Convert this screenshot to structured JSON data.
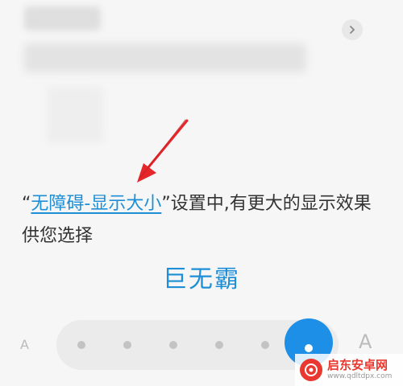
{
  "description": {
    "quote_open": "“",
    "link_text": "无障碍-显示大小",
    "quote_close": "”",
    "rest": "设置中,有更大的显示效果供您选择"
  },
  "preview_text": "巨无霸",
  "slider": {
    "min_label": "A",
    "max_label": "A",
    "positions": 6,
    "selected_index": 5
  },
  "icons": {
    "chevron": "chevron-right-icon",
    "annotation": "red-arrow-icon",
    "watermark_logo": "qdltd-logo"
  },
  "watermark": {
    "name": "启东安卓网",
    "url": "www.qdltdpx.com"
  },
  "colors": {
    "accent": "#1e8fd6",
    "arrow": "#e5262a",
    "background": "#f6f6f6"
  }
}
